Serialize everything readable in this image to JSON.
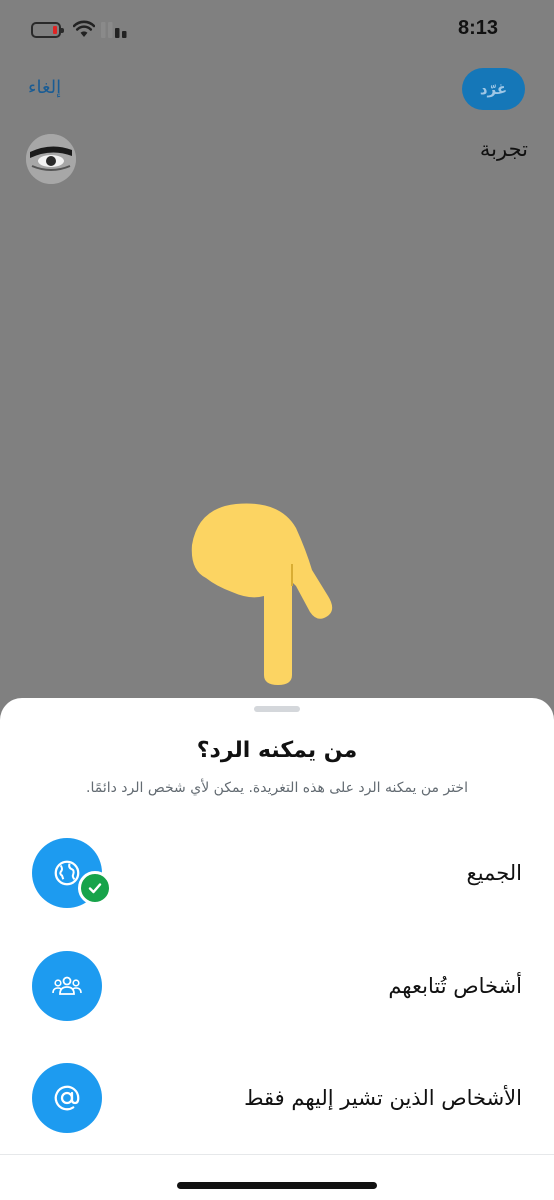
{
  "status_bar": {
    "time": "8:13",
    "battery_icon": "battery-low-icon",
    "wifi_icon": "wifi-icon",
    "signal_icon": "cellular-signal-icon"
  },
  "header": {
    "tweet_button_label": "غرّد",
    "cancel_label": "إلغاء"
  },
  "compose": {
    "draft_text": "تجربة",
    "avatar_icon": "avatar"
  },
  "overlay": {
    "pointer_icon": "pointing-hand-down-icon"
  },
  "reply_sheet": {
    "title": "من يمكنه الرد؟",
    "subtitle": "اختر من يمكنه الرد على هذه التغريدة. يمكن لأي شخص الرد دائمًا.",
    "options": [
      {
        "label": "الجميع",
        "icon": "globe-icon",
        "selected": true
      },
      {
        "label": "أشخاص تُتابعهم",
        "icon": "people-icon",
        "selected": false
      },
      {
        "label": "الأشخاص الذين تشير إليهم فقط",
        "icon": "at-icon",
        "selected": false
      }
    ]
  },
  "colors": {
    "accent": "#1d9bf0",
    "tweet_button_bg": "#1577b8",
    "selected_check": "#17a34a",
    "dim_overlay": "#808080"
  }
}
